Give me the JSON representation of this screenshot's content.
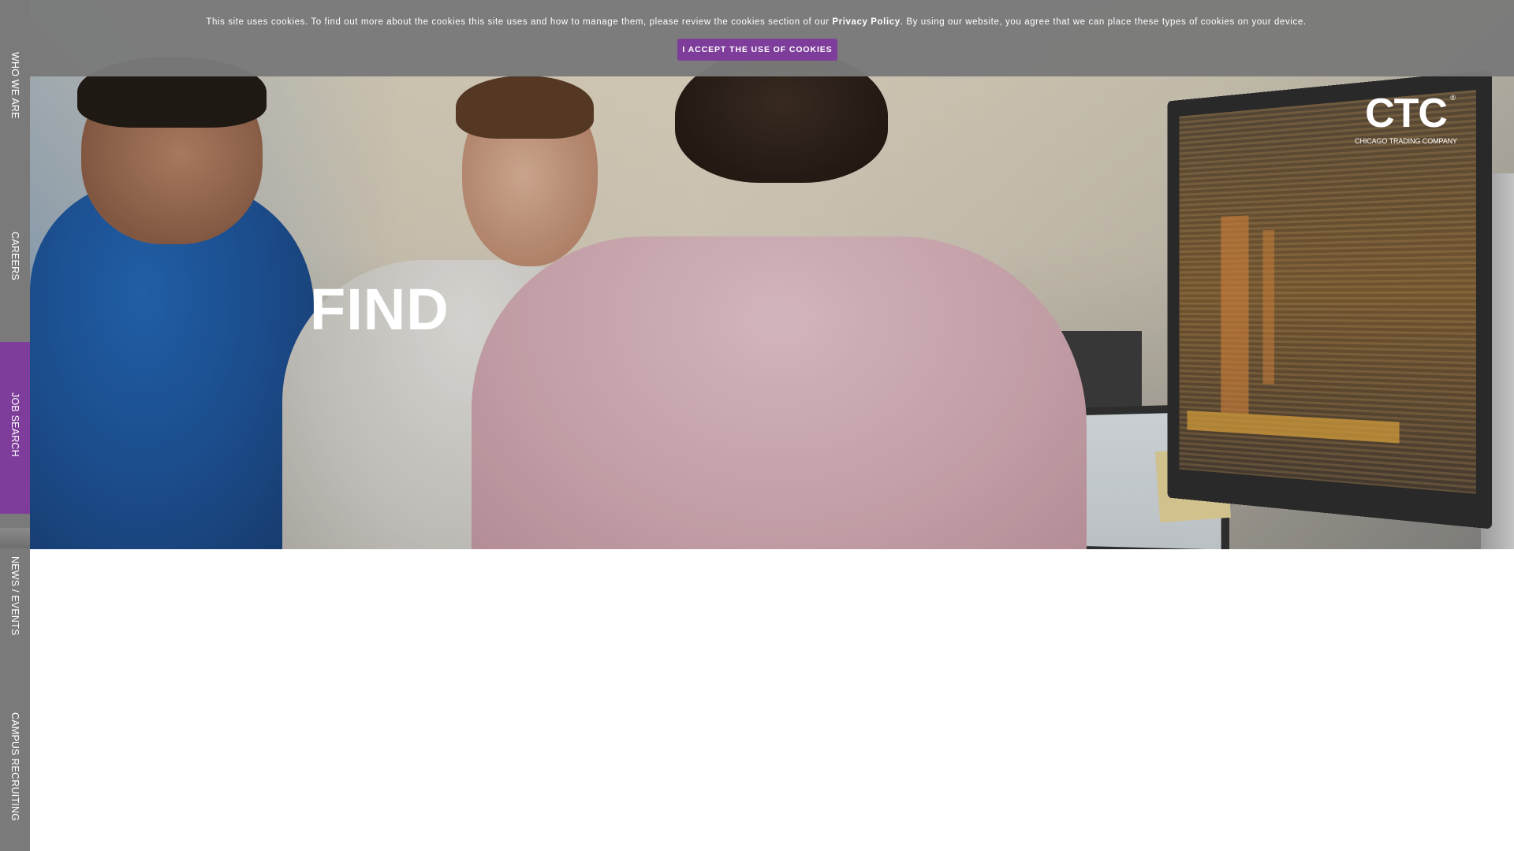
{
  "side_nav": {
    "items": [
      {
        "label": "WHO WE ARE",
        "active": false
      },
      {
        "label": "CAREERS",
        "active": false
      },
      {
        "label": "JOB SEARCH",
        "active": true
      },
      {
        "label": "NEWS / EVENTS",
        "active": false
      },
      {
        "label": "CAMPUS RECRUITING",
        "active": false
      }
    ],
    "active_color": "#7e3d9a",
    "background_color": "#7a7a7a"
  },
  "cookie_banner": {
    "text_before": "This site uses cookies. To find out more about the cookies this site uses and how to manage them, please review the cookies section of our ",
    "policy_link": "Privacy Policy",
    "text_after": ". By using our website, you agree that we can place these types of cookies on your device.",
    "accept_button": "I ACCEPT THE USE OF COOKIES",
    "button_color": "#7e3d9a"
  },
  "hero": {
    "heading": "FIND",
    "image_icon": "office-trading-floor-photo"
  },
  "logo": {
    "mark": "CTC",
    "registered": "®",
    "subtitle": "CHICAGO TRADING COMPANY"
  }
}
